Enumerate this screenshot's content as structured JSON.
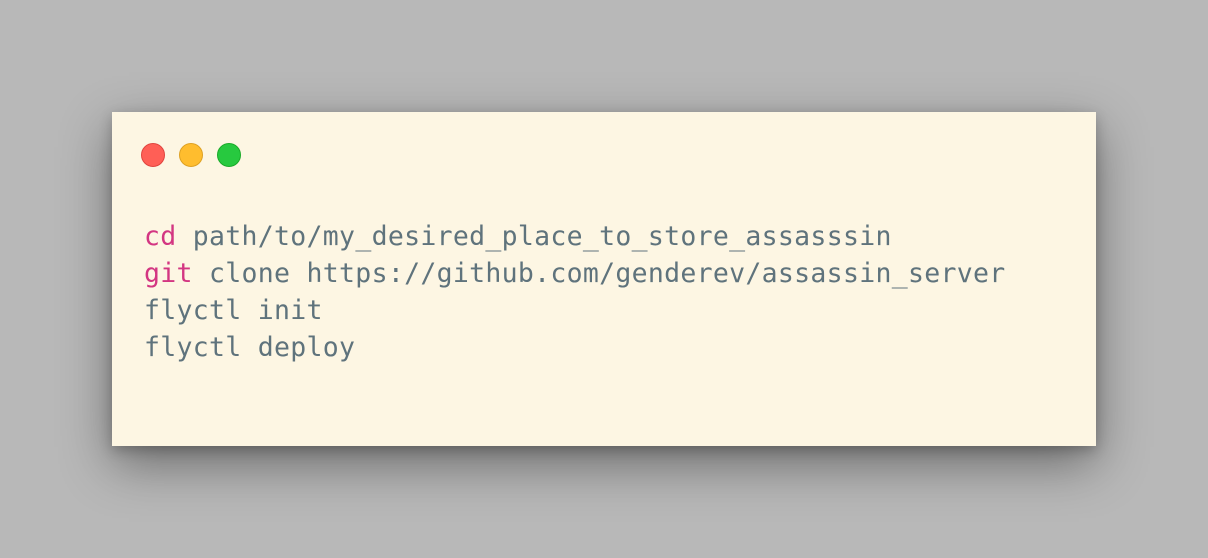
{
  "window": {
    "controls": {
      "close": {
        "icon": "close-circle-icon",
        "color": "#ff5f56"
      },
      "minimize": {
        "icon": "minimize-circle-icon",
        "color": "#ffbd2e"
      },
      "maximize": {
        "icon": "maximize-circle-icon",
        "color": "#27c93f"
      }
    },
    "background": "#fdf6e3"
  },
  "code": {
    "keyword_color": "#d33682",
    "text_color": "#5f737c",
    "lines": [
      {
        "command": "cd",
        "args": " path/to/my_desired_place_to_store_assasssin"
      },
      {
        "command": "git",
        "args": " clone https://github.com/genderev/assassin_server"
      },
      {
        "command": "",
        "args": "flyctl init"
      },
      {
        "command": "",
        "args": "flyctl deploy"
      }
    ]
  }
}
